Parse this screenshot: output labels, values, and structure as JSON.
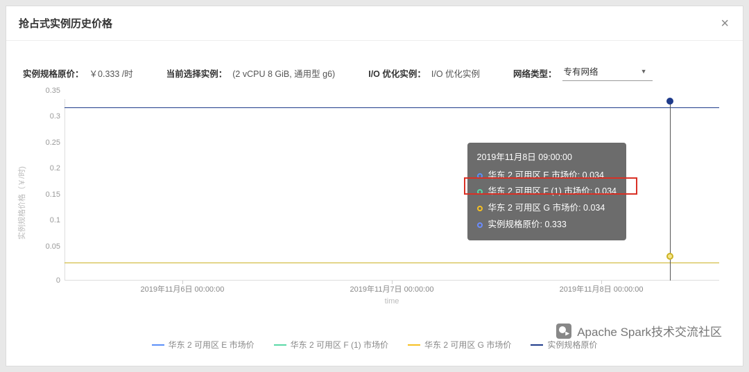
{
  "modal": {
    "title": "抢占式实例历史价格",
    "close_label": "×"
  },
  "info": {
    "spec_price_label": "实例规格原价：",
    "spec_price_value": "￥0.333 /时",
    "current_label": "当前选择实例：",
    "current_value": "(2 vCPU 8 GiB, 通用型 g6)",
    "io_label": "I/O 优化实例：",
    "io_value": "I/O 优化实例",
    "net_label": "网络类型：",
    "net_value": "专有网络"
  },
  "chart_data": {
    "type": "line",
    "ylabel": "实例规格价格（￥/时)",
    "xlabel": "time",
    "ylim": [
      0,
      0.35
    ],
    "y_ticks": [
      0,
      0.05,
      0.1,
      0.15,
      0.2,
      0.25,
      0.3,
      0.35
    ],
    "x_ticks": [
      "2019年11月6日 00:00:00",
      "2019年11月7日 00:00:00",
      "2019年11月8日 00:00:00"
    ],
    "series": [
      {
        "name": "华东 2 可用区 E 市场价",
        "color": "#5b8ff9",
        "constant": 0.034
      },
      {
        "name": "华东 2 可用区 F (1) 市场价",
        "color": "#5ad8a6",
        "constant": 0.034
      },
      {
        "name": "华东 2 可用区 G 市场价",
        "color": "#f6c022",
        "constant": 0.034
      },
      {
        "name": "实例规格原价",
        "color": "#1e3a8a",
        "constant": 0.333
      }
    ],
    "hover_time": "2019年11月8日 09:00:00",
    "tooltip": {
      "title": "2019年11月8日 09:00:00",
      "rows": [
        {
          "label": "华东 2 可用区 E 市场价: 0.034",
          "color": "#5b8ff9"
        },
        {
          "label": "华东 2 可用区 F (1) 市场价: 0.034",
          "color": "#5ad8a6"
        },
        {
          "label": "华东 2 可用区 G 市场价: 0.034",
          "color": "#f6c022"
        },
        {
          "label": "实例规格原价: 0.333",
          "color": "#1e3a8a"
        }
      ]
    }
  },
  "legend": [
    {
      "label": "华东 2 可用区 E 市场价",
      "color": "#5b8ff9"
    },
    {
      "label": "华东 2 可用区 F (1) 市场价",
      "color": "#5ad8a6"
    },
    {
      "label": "华东 2 可用区 G 市场价",
      "color": "#f6c022"
    },
    {
      "label": "实例规格原价",
      "color": "#1e3a8a"
    }
  ],
  "watermark": "Apache Spark技术交流社区"
}
